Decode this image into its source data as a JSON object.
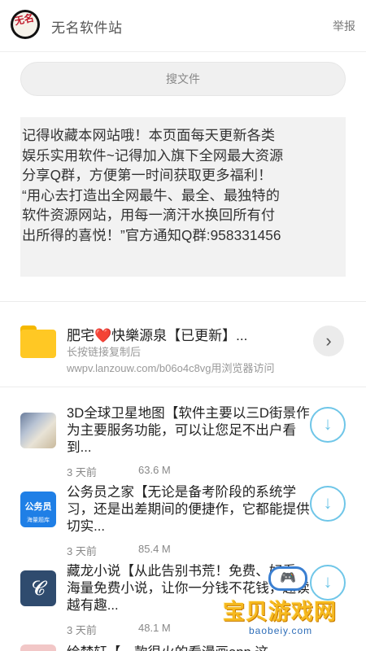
{
  "header": {
    "logo_text": "无名",
    "site_title": "无名软件站",
    "report_label": "举报"
  },
  "search": {
    "label": "搜文件"
  },
  "notice": {
    "lines": [
      "记得收藏本网站哦！本页面每天更新各类",
      "娱乐实用软件~记得加入旗下全网最大资源",
      "分享Q群，方便第一时间获取更多福利！",
      "“用心去打造出全网最牛、最全、最独特的",
      "软件资源网站，用每一滴汗水换回所有付",
      "出所得的喜悦！”官方通知Q群:958331456"
    ]
  },
  "folder": {
    "title_prefix": "肥宅",
    "heart": "❤️",
    "title_suffix": "快樂源泉【已更新】...",
    "subtitle": "长按链接复制后",
    "url_text": "wwpv.lanzouw.com/b06o4c8vg用浏览器访问",
    "arrow_icon": "chevron-right-icon",
    "arrow_glyph": "›"
  },
  "files": [
    {
      "title": "3D全球卫星地图【软件主要以三D街景作为主要服务功能，可以让您足不出户看到...",
      "date": "3 天前",
      "size": "63.6 M",
      "thumb": "map"
    },
    {
      "title": "公务员之家【无论是备考阶段的系统学习，还是出差期间的便捷作，它都能提供切实...",
      "date": "3 天前",
      "size": "85.4 M",
      "thumb": "gwy",
      "thumb_line1": "公务员",
      "thumb_line2": "海量题库"
    },
    {
      "title": "藏龙小说【从此告别书荒！免费、好看、海量免费小说，让你一分钱不花钱，越读越有趣...",
      "date": "3 天前",
      "size": "48.1 M",
      "thumb": "zc",
      "thumb_glyph": "𝓒"
    }
  ],
  "download_glyph": "↓",
  "partial_item": {
    "title": "绘梦轩【一款很火的看漫画app,这"
  },
  "watermark": {
    "text": "宝贝游戏网",
    "url": "baobeiy.com",
    "pad_glyph": "🎮"
  },
  "colors": {
    "accent_download": "#6fc6e8",
    "folder": "#ffc824",
    "heart": "#e0243a",
    "watermark_text": "#f6b91e"
  }
}
